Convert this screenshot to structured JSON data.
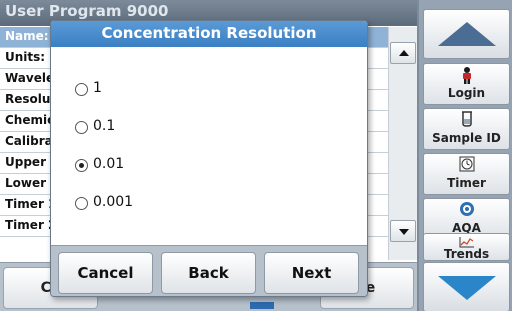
{
  "background": {
    "title": "User Program 9000",
    "rows": [
      "Name:",
      "Units:",
      "Wavele",
      "Resolu",
      "Chemic",
      "Calibra",
      "Upper",
      "Lower",
      "Timer 1",
      "Timer 2"
    ],
    "bottom_left_label": "Ca",
    "bottom_right_label": "re"
  },
  "sidebar": {
    "items": [
      {
        "label": "Login",
        "icon": "login-icon"
      },
      {
        "label": "Sample ID",
        "icon": "sample-id-icon"
      },
      {
        "label": "Timer",
        "icon": "timer-icon"
      },
      {
        "label": "AQA",
        "icon": "aqa-icon"
      },
      {
        "label": "Trends",
        "icon": "trends-icon"
      }
    ]
  },
  "dialog": {
    "title": "Concentration Resolution",
    "options": [
      {
        "label": "1",
        "selected": false
      },
      {
        "label": "0.1",
        "selected": false
      },
      {
        "label": "0.01",
        "selected": true
      },
      {
        "label": "0.001",
        "selected": false
      }
    ],
    "buttons": {
      "cancel": "Cancel",
      "back": "Back",
      "next": "Next"
    }
  },
  "colors": {
    "dialog_title": "#3b7fc4",
    "sidebar": "#95a3b2",
    "selected_row": "#8fb3d6",
    "down_arrow": "#2a86c9"
  }
}
